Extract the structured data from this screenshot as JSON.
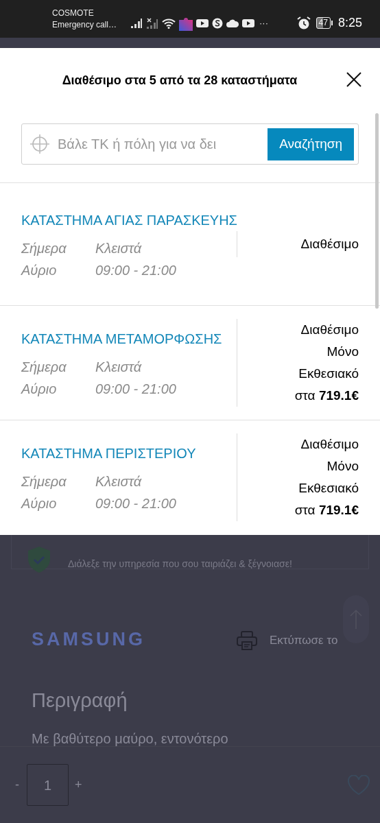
{
  "status_bar": {
    "carrier": "COSMOTE",
    "network_note": "Emergency call…",
    "more": "···",
    "battery": "47",
    "time": "8:25"
  },
  "modal": {
    "title": "Διαθέσιμο στα 5 από τα 28 καταστήματα",
    "search": {
      "placeholder": "Βάλε ΤΚ ή πόλη για να δει",
      "button": "Αναζήτηση"
    },
    "stores": [
      {
        "name": "ΚΑΤΑΣΤΗΜΑ ΑΓΙΑΣ ΠΑΡΑΣΚΕΥΗΣ",
        "hours": [
          {
            "day": "Σήμερα",
            "time": "Κλειστά"
          },
          {
            "day": "Αύριο",
            "time": "09:00 - 21:00"
          }
        ],
        "availability": [
          "Διαθέσιμο"
        ]
      },
      {
        "name": "ΚΑΤΑΣΤΗΜΑ ΜΕΤΑΜΟΡΦΩΣΗΣ",
        "hours": [
          {
            "day": "Σήμερα",
            "time": "Κλειστά"
          },
          {
            "day": "Αύριο",
            "time": "09:00 - 21:00"
          }
        ],
        "availability": [
          "Διαθέσιμο",
          "Μόνο",
          "Εκθεσιακό",
          "στα **719.1€**"
        ]
      },
      {
        "name": "ΚΑΤΑΣΤΗΜΑ ΠΕΡΙΣΤΕΡΙΟΥ",
        "hours": [
          {
            "day": "Σήμερα",
            "time": "Κλειστά"
          },
          {
            "day": "Αύριο",
            "time": "09:00 - 21:00"
          }
        ],
        "availability": [
          "Διαθέσιμο",
          "Μόνο",
          "Εκθεσιακό",
          "στα **719.1€**"
        ]
      }
    ]
  },
  "page": {
    "service_note": "Διάλεξε την υπηρεσία που σου ταιριάζει & ξέγνοιασε!",
    "brand": "SAMSUNG",
    "print": "Εκτύπωσε το",
    "section_title": "Περιγραφή",
    "description": "Με βαθύτερο μαύρο, εντονότερο",
    "quantity": {
      "minus": "-",
      "value": "1",
      "plus": "+"
    }
  }
}
